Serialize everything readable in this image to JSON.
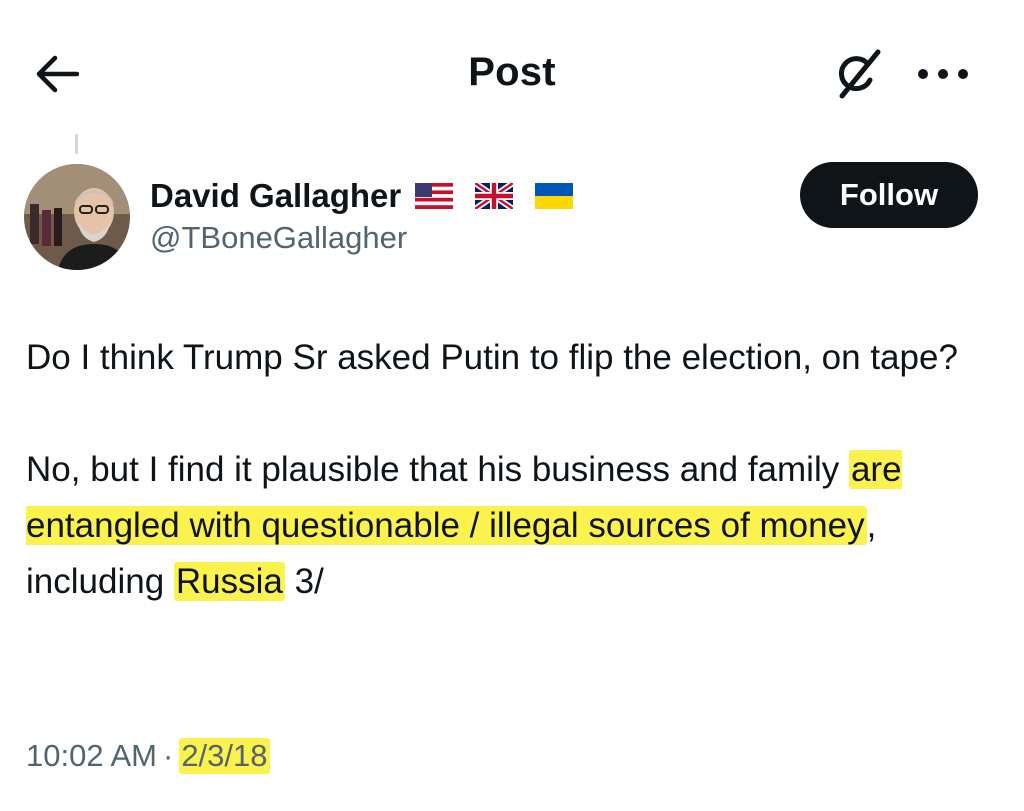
{
  "header": {
    "title": "Post",
    "back_icon": "arrow-left-icon",
    "grok_icon": "grok-icon",
    "more_icon": "more-horizontal-icon"
  },
  "author": {
    "display_name": "David Gallagher",
    "flags": [
      "🇺🇸",
      "🇬🇧",
      "🇺🇦"
    ],
    "handle": "@TBoneGallagher",
    "follow_label": "Follow"
  },
  "post": {
    "paragraph1": "Do I think Trump Sr asked Putin to flip the election, on tape?",
    "p2_part1": "No, but I find it plausible that his business and family ",
    "p2_hl1": "are entangled with questionable / illegal sources of money",
    "p2_part2": ", including ",
    "p2_hl2": "Russia",
    "p2_part3": " 3/"
  },
  "meta": {
    "time": "10:02 AM",
    "separator": "·",
    "date": "2/3/18"
  },
  "colors": {
    "text": "#0f1419",
    "secondary": "#536471",
    "highlight": "#fbf24d",
    "follow_bg": "#0f1419"
  }
}
